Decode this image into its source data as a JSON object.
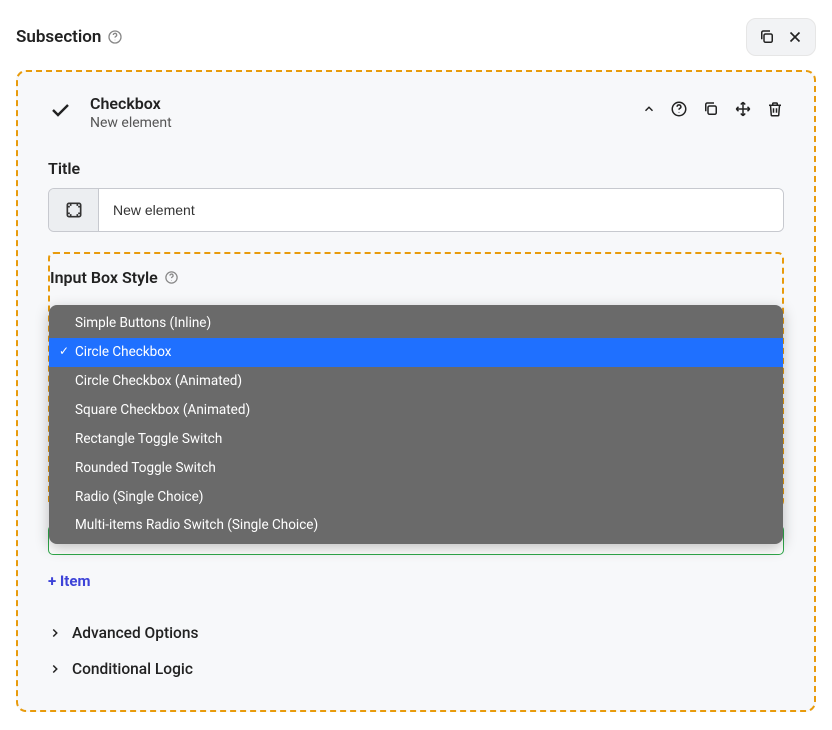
{
  "page": {
    "title": "Subsection"
  },
  "element": {
    "type": "Checkbox",
    "subtitle": "New element"
  },
  "title_section": {
    "label": "Title",
    "value": "New element"
  },
  "input_box_style": {
    "label": "Input Box Style",
    "options": [
      "Simple Buttons (Inline)",
      "Circle Checkbox",
      "Circle Checkbox (Animated)",
      "Square Checkbox (Animated)",
      "Rectangle Toggle Switch",
      "Rounded Toggle Switch",
      "Radio (Single Choice)",
      "Multi-items Radio Switch (Single Choice)"
    ],
    "selected_index": 1
  },
  "add_item": "+ Item",
  "accordion": {
    "advanced": "Advanced Options",
    "conditional": "Conditional Logic"
  }
}
